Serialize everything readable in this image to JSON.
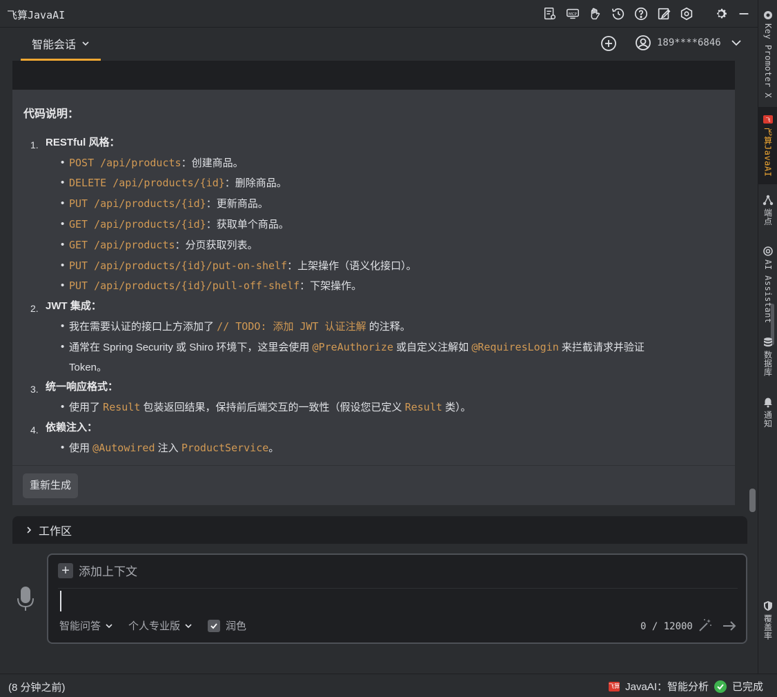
{
  "window": {
    "title": "飞算JavaAI"
  },
  "toolbar": {
    "icons": [
      "doc-settings-icon",
      "mcp-icon",
      "gesture-icon",
      "history-icon",
      "help-icon",
      "edit-icon",
      "hex-settings-icon",
      "gear-icon",
      "minimize-icon"
    ]
  },
  "header": {
    "tab_label": "智能会话",
    "username": "189****6846"
  },
  "answer": {
    "heading": "代码说明：",
    "sections": [
      {
        "num": "1.",
        "title": "RESTful 风格：",
        "items": [
          {
            "code": "POST /api/products",
            "text": "：创建商品。"
          },
          {
            "code": "DELETE /api/products/{id}",
            "text": "：删除商品。"
          },
          {
            "code": "PUT /api/products/{id}",
            "text": "：更新商品。"
          },
          {
            "code": "GET /api/products/{id}",
            "text": "：获取单个商品。"
          },
          {
            "code": "GET /api/products",
            "text": "：分页获取列表。"
          },
          {
            "code": "PUT /api/products/{id}/put-on-shelf",
            "text": "：上架操作（语义化接口）。"
          },
          {
            "code": "PUT /api/products/{id}/pull-off-shelf",
            "text": "：下架操作。"
          }
        ]
      },
      {
        "num": "2.",
        "title": "JWT 集成：",
        "items": [
          {
            "pre": "我在需要认证的接口上方添加了 ",
            "code": "// TODO: 添加 JWT 认证注解",
            "text": " 的注释。"
          },
          {
            "pre": "通常在 Spring Security 或 Shiro 环境下，这里会使用 ",
            "code": "@PreAuthorize",
            "mid": " 或自定义注解如 ",
            "code2": "@RequiresLogin",
            "text": " 来拦截请求并验证",
            "line2": "Token。"
          }
        ]
      },
      {
        "num": "3.",
        "title": "统一响应格式：",
        "items": [
          {
            "pre": "使用了 ",
            "code": "Result",
            "mid": " 包装返回结果，保持前后端交互的一致性（假设您已定义 ",
            "code2": "Result",
            "text": " 类）。"
          }
        ]
      },
      {
        "num": "4.",
        "title": "依赖注入：",
        "items": [
          {
            "pre": "使用 ",
            "code": "@Autowired",
            "mid": " 注入 ",
            "code2": "ProductService",
            "text": "。"
          }
        ]
      }
    ],
    "regenerate_label": "重新生成"
  },
  "workspace": {
    "label": "工作区"
  },
  "input": {
    "add_context_label": "添加上下文",
    "mode_label": "智能问答",
    "edition_label": "个人专业版",
    "polish_label": "润色",
    "polish_checked": true,
    "counter": "0 / 12000"
  },
  "status": {
    "left_text": "(8 分钟之前)",
    "task_text": "JavaAI：智能分析",
    "done_text": "已完成",
    "logo_text": "飞算"
  },
  "right_strip": {
    "items": [
      {
        "label": "Key Promoter X",
        "icon": "key-promoter-icon"
      },
      {
        "label": "飞算JavaAI",
        "icon": "javaai-icon",
        "active": true
      },
      {
        "label": "端点",
        "icon": "endpoints-icon"
      },
      {
        "label": "AI Assistant",
        "icon": "ai-assistant-icon"
      },
      {
        "label": "数据库",
        "icon": "database-icon"
      },
      {
        "label": "通知",
        "icon": "bell-icon"
      },
      {
        "label": "覆盖率",
        "icon": "shield-icon"
      }
    ]
  },
  "colors": {
    "accent": "#f0a732",
    "code": "#d29a54",
    "bg": "#2b2d30",
    "card": "#393b40",
    "dark": "#1e1f22"
  }
}
